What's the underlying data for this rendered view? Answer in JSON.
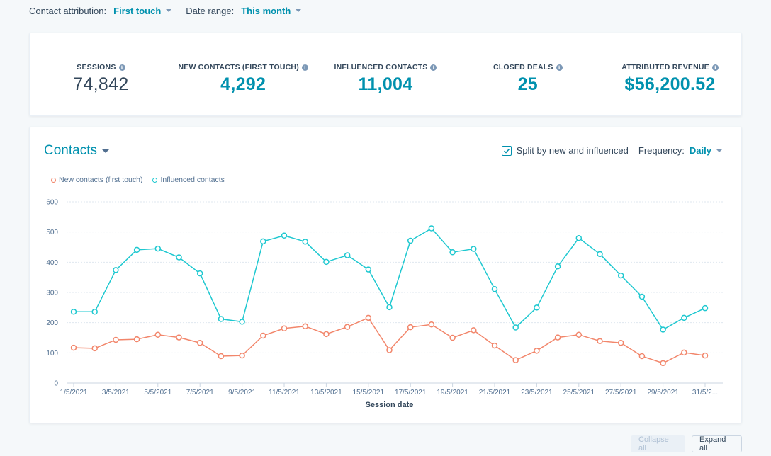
{
  "filters": {
    "attribution": {
      "label": "Contact attribution:",
      "value": "First touch"
    },
    "date_range": {
      "label": "Date range:",
      "value": "This month"
    }
  },
  "kpis": [
    {
      "label": "SESSIONS",
      "value": "74,842",
      "style": "plain"
    },
    {
      "label": "NEW CONTACTS (FIRST TOUCH)",
      "value": "4,292",
      "style": "accent"
    },
    {
      "label": "INFLUENCED CONTACTS",
      "value": "11,004",
      "style": "accent"
    },
    {
      "label": "CLOSED DEALS",
      "value": "25",
      "style": "accent"
    },
    {
      "label": "ATTRIBUTED REVENUE",
      "value": "$56,200.52",
      "style": "accent"
    }
  ],
  "info_icon_glyph": "i",
  "chart_panel": {
    "title": "Contacts",
    "split_checkbox": {
      "label": "Split by new and influenced",
      "checked": true
    },
    "frequency": {
      "label": "Frequency:",
      "value": "Daily"
    }
  },
  "buttons": {
    "collapse_all": "Collapse all",
    "expand_all": "Expand all"
  },
  "colors": {
    "accent": "#0091ae",
    "new_contacts": "#f2866b",
    "influenced_contacts": "#1ec8d0"
  },
  "chart_data": {
    "type": "line",
    "title": "Contacts",
    "xlabel": "Session date",
    "ylabel": "",
    "ylim": [
      0,
      600
    ],
    "yticks": [
      0,
      100,
      200,
      300,
      400,
      500,
      600
    ],
    "grid": true,
    "legend_position": "top-left",
    "x": [
      "1/5/2021",
      "2/5/2021",
      "3/5/2021",
      "4/5/2021",
      "5/5/2021",
      "6/5/2021",
      "7/5/2021",
      "8/5/2021",
      "9/5/2021",
      "10/5/2021",
      "11/5/2021",
      "12/5/2021",
      "13/5/2021",
      "14/5/2021",
      "15/5/2021",
      "16/5/2021",
      "17/5/2021",
      "18/5/2021",
      "19/5/2021",
      "20/5/2021",
      "21/5/2021",
      "22/5/2021",
      "23/5/2021",
      "24/5/2021",
      "25/5/2021",
      "26/5/2021",
      "27/5/2021",
      "28/5/2021",
      "29/5/2021",
      "30/5/2021",
      "31/5/2021"
    ],
    "xtick_labels": [
      "1/5/2021",
      "3/5/2021",
      "5/5/2021",
      "7/5/2021",
      "9/5/2021",
      "11/5/2021",
      "13/5/2021",
      "15/5/2021",
      "17/5/2021",
      "19/5/2021",
      "21/5/2021",
      "23/5/2021",
      "25/5/2021",
      "27/5/2021",
      "29/5/2021",
      "31/5/2..."
    ],
    "series": [
      {
        "name": "New contacts (first touch)",
        "color": "#f2866b",
        "values": [
          117,
          115,
          143,
          145,
          160,
          151,
          133,
          89,
          91,
          157,
          181,
          188,
          162,
          186,
          216,
          109,
          185,
          194,
          150,
          175,
          124,
          76,
          107,
          151,
          160,
          139,
          133,
          89,
          66,
          101,
          91
        ]
      },
      {
        "name": "Influenced contacts",
        "color": "#1ec8d0",
        "values": [
          236,
          236,
          374,
          441,
          445,
          416,
          363,
          212,
          203,
          469,
          488,
          468,
          401,
          423,
          376,
          251,
          471,
          512,
          433,
          444,
          311,
          184,
          250,
          386,
          480,
          427,
          356,
          286,
          177,
          216,
          248
        ]
      }
    ]
  }
}
